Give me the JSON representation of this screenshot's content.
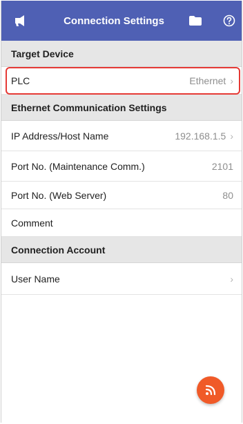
{
  "header": {
    "title": "Connection Settings",
    "left_icon": "megaphone-icon",
    "folder_icon": "folder-icon",
    "help_icon": "help-circle-icon",
    "bg_color": "#4f60b4"
  },
  "sections": {
    "target_device": "Target Device",
    "ethernet_settings": "Ethernet Communication Settings",
    "connection_account": "Connection Account"
  },
  "rows": {
    "plc": {
      "label": "PLC",
      "value": "Ethernet"
    },
    "ip_address": {
      "label": "IP Address/Host Name",
      "value": "192.168.1.5"
    },
    "port_maintenance": {
      "label": "Port No. (Maintenance Comm.)",
      "value": "2101"
    },
    "port_web": {
      "label": "Port No. (Web Server)",
      "value": "80"
    },
    "comment": {
      "label": "Comment",
      "value": ""
    },
    "user_name": {
      "label": "User Name",
      "value": ""
    }
  },
  "fab": {
    "icon": "connect-signal-icon",
    "color": "#f05a28"
  },
  "highlight_color": "#e53935"
}
